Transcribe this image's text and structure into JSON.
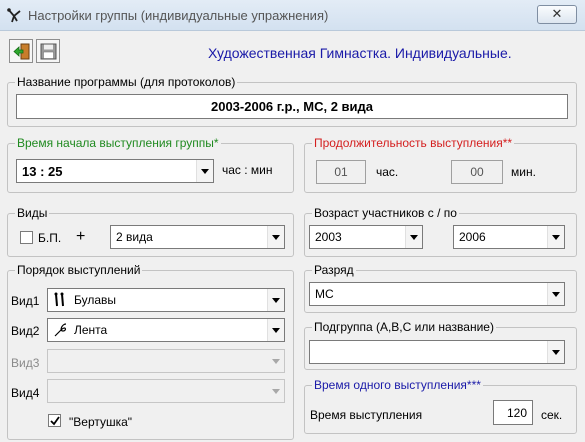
{
  "window": {
    "title": "Настройки группы (индивидуальные упражнения)",
    "close_glyph": "✕"
  },
  "toolbar": {
    "exit_icon": "exit-door-icon",
    "save_icon": "floppy-disk-icon",
    "header_title": "Художественная Гимнастка. Индивидуальные."
  },
  "program": {
    "legend": "Название программы (для протоколов)",
    "value": "2003-2006 г.р., МС, 2 вида"
  },
  "start_time": {
    "legend": "Время начала выступления группы*",
    "value": "13 : 25",
    "unit_label": "час : мин",
    "legend_color": "#208a20"
  },
  "duration": {
    "legend": "Продолжительность выступления**",
    "hours_value": "01",
    "hours_label": "час.",
    "minutes_value": "00",
    "minutes_label": "мин.",
    "legend_color": "#d42020"
  },
  "events": {
    "legend": "Виды",
    "bp_label": "Б.П.",
    "bp_checked": false,
    "plus": "+",
    "select_value": "2 вида"
  },
  "age": {
    "legend": "Возраст участников с / по",
    "from": "2003",
    "to": "2006"
  },
  "order": {
    "legend": "Порядок выступлений",
    "rows": [
      {
        "label": "Вид1",
        "icon": "clubs-icon",
        "value": "Булавы",
        "enabled": true
      },
      {
        "label": "Вид2",
        "icon": "ribbon-icon",
        "value": "Лента",
        "enabled": true
      },
      {
        "label": "Вид3",
        "icon": "",
        "value": "",
        "enabled": false
      },
      {
        "label": "Вид4",
        "icon": "",
        "value": "",
        "enabled": false
      }
    ],
    "spinner_label": "\"Вертушка\"",
    "spinner_checked": true
  },
  "rank": {
    "legend": "Разряд",
    "value": "МС"
  },
  "subgroup": {
    "legend": "Подгруппа (А,В,С или название)",
    "value": ""
  },
  "performance_time": {
    "legend": "Время одного выступления***",
    "label": "Время выступления",
    "value": "120",
    "unit": "сек.",
    "legend_color": "#1a1aa8"
  }
}
